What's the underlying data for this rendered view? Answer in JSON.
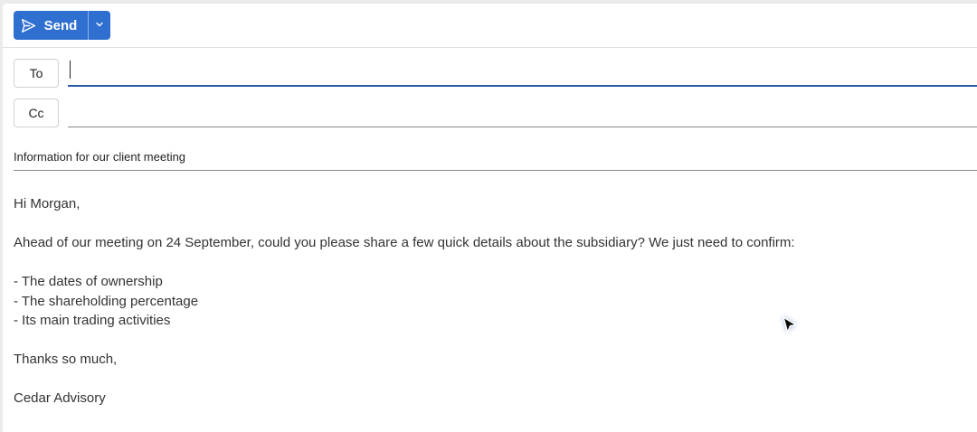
{
  "toolbar": {
    "send_label": "Send",
    "send_icon": "paper-plane-icon",
    "dropdown_icon": "chevron-down-icon"
  },
  "recipients": {
    "to_label": "To",
    "to_value": "",
    "cc_label": "Cc",
    "cc_value": ""
  },
  "subject": "Information for our client meeting",
  "body": {
    "lines": [
      "Hi Morgan,",
      "",
      "Ahead of our meeting on 24 September, could you please share a few quick details about the subsidiary? We just need to confirm:",
      "",
      "- The dates of ownership",
      "- The shareholding percentage",
      "- Its main trading activities",
      "",
      "Thanks so much,",
      "",
      "Cedar Advisory"
    ]
  },
  "colors": {
    "accent": "#2f6fd0",
    "focus_underline": "#2b5aa8"
  },
  "pointer_icon": "mouse-pointer-icon"
}
